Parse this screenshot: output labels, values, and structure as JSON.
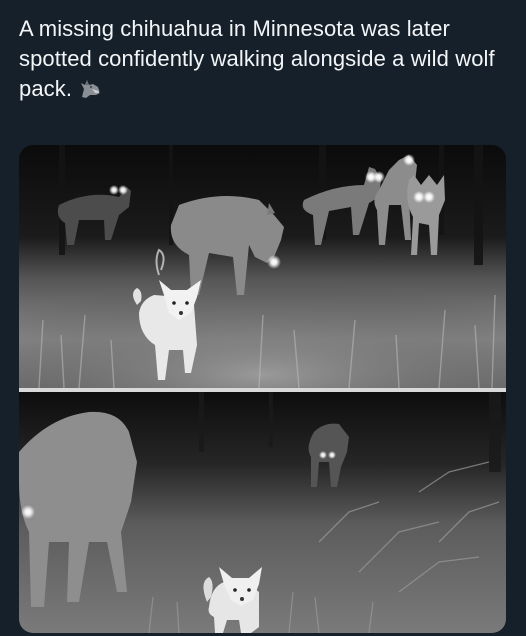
{
  "post": {
    "text": "A missing chihuahua in Minnesota was later spotted confidently walking alongside a wild wolf pack.",
    "emoji_icon": "wolf-emoji-icon"
  },
  "media": {
    "photo_count": 2,
    "photos": [
      {
        "subject": "wolf-pack-with-chihuahua-night-trail-camera",
        "eye_glow_color": "#ffffff"
      },
      {
        "subject": "wolf-and-chihuahua-night-trail-camera",
        "eye_glow_color": "#ffffff"
      }
    ]
  },
  "colors": {
    "background": "#15202b",
    "text": "#f3f5f7",
    "divider": "#d9d9d9"
  }
}
